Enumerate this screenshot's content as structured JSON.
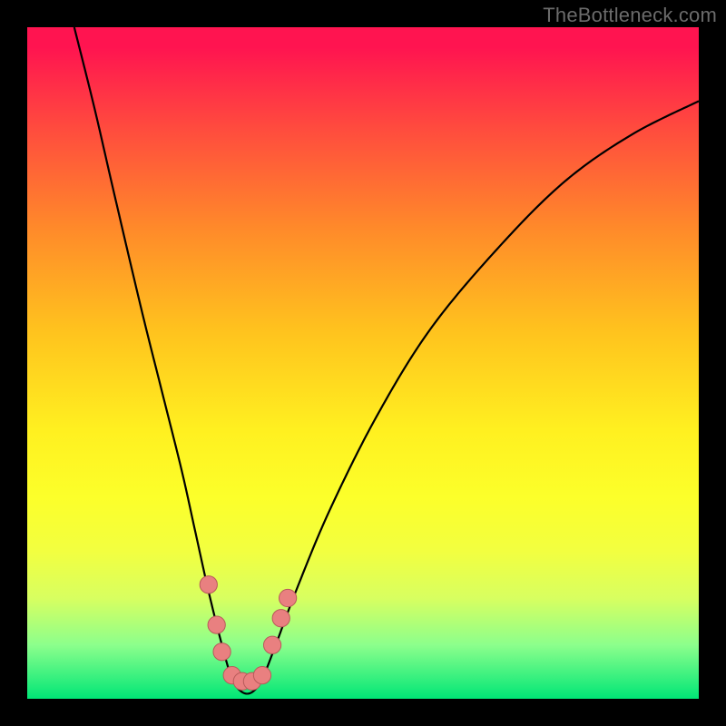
{
  "watermark": "TheBottleneck.com",
  "colors": {
    "background": "#000000",
    "curve": "#000000",
    "marker_fill": "#e98080",
    "marker_stroke": "#b85a5a"
  },
  "chart_data": {
    "type": "line",
    "title": "",
    "xlabel": "",
    "ylabel": "",
    "xlim": [
      0,
      100
    ],
    "ylim": [
      0,
      100
    ],
    "background": "heatmap-gradient (red=high bottleneck, green=low bottleneck)",
    "series": [
      {
        "name": "bottleneck-curve",
        "x": [
          7,
          10,
          13,
          17,
          20,
          23,
          25,
          27,
          29,
          30.5,
          32,
          33.5,
          35,
          37,
          40,
          45,
          52,
          60,
          70,
          80,
          90,
          100
        ],
        "y": [
          100,
          88,
          75,
          58,
          46,
          34,
          25,
          16,
          8,
          3,
          1,
          1,
          3,
          8,
          16,
          28,
          42,
          55,
          67,
          77,
          84,
          89
        ]
      }
    ],
    "markers": [
      {
        "x": 27.0,
        "y": 17
      },
      {
        "x": 28.2,
        "y": 11
      },
      {
        "x": 29.0,
        "y": 7
      },
      {
        "x": 30.5,
        "y": 3.5
      },
      {
        "x": 32.0,
        "y": 2.6
      },
      {
        "x": 33.5,
        "y": 2.6
      },
      {
        "x": 35.0,
        "y": 3.5
      },
      {
        "x": 36.5,
        "y": 8
      },
      {
        "x": 37.8,
        "y": 12
      },
      {
        "x": 38.8,
        "y": 15
      }
    ],
    "marker_radius_plot_units": 1.3
  }
}
